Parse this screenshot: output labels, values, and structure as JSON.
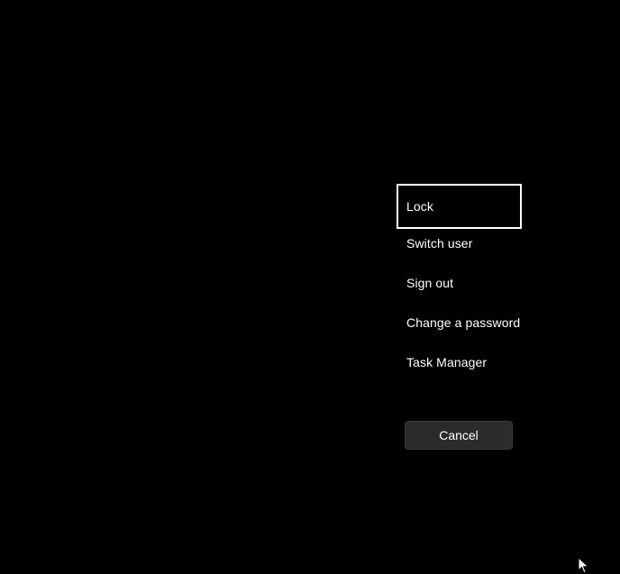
{
  "ctrl_alt_del_menu": {
    "items": [
      {
        "label": "Lock"
      },
      {
        "label": "Switch user"
      },
      {
        "label": "Sign out"
      },
      {
        "label": "Change a password"
      },
      {
        "label": "Task Manager"
      }
    ],
    "focused_item": "Lock",
    "cancel_label": "Cancel"
  },
  "colors": {
    "background": "#000000",
    "text": "#ffffff",
    "focus_border": "#ffffff",
    "button_bg": "#2b2b2b"
  },
  "icons": {
    "cursor": "mouse-pointer-icon"
  }
}
